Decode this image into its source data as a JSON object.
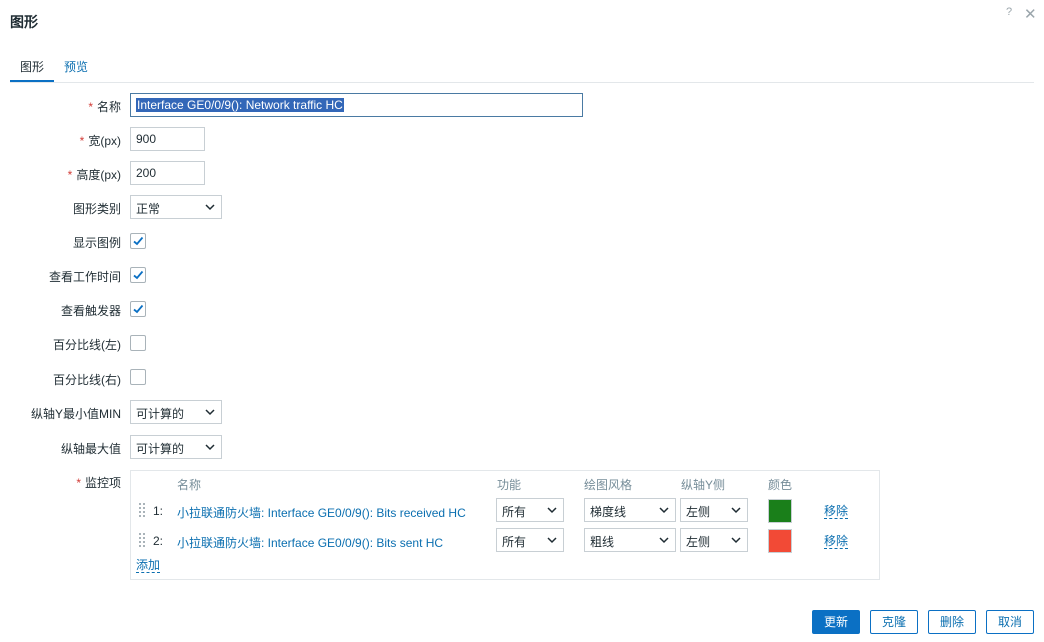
{
  "dialog": {
    "title": "图形",
    "help_glyph": "?",
    "close_glyph": "✕"
  },
  "tabs": [
    {
      "label": "图形",
      "active": true
    },
    {
      "label": "预览",
      "active": false
    }
  ],
  "form": {
    "name": {
      "label": "名称",
      "required": true,
      "value": "Interface GE0/0/9(): Network traffic HC"
    },
    "width": {
      "label": "宽(px)",
      "required": true,
      "value": "900"
    },
    "height": {
      "label": "高度(px)",
      "required": true,
      "value": "200"
    },
    "graph_type": {
      "label": "图形类别",
      "value": "正常"
    },
    "show_legend": {
      "label": "显示图例",
      "checked": true
    },
    "show_working_time": {
      "label": "查看工作时间",
      "checked": true
    },
    "show_triggers": {
      "label": "查看触发器",
      "checked": true
    },
    "percentile_left": {
      "label": "百分比线(左)",
      "checked": false
    },
    "percentile_right": {
      "label": "百分比线(右)",
      "checked": false
    },
    "ymin": {
      "label": "纵轴Y最小值MIN",
      "value": "可计算的"
    },
    "ymax": {
      "label": "纵轴最大值",
      "value": "可计算的"
    },
    "items_label": "监控项",
    "required_mark": "*"
  },
  "items": {
    "headers": {
      "name": "名称",
      "function": "功能",
      "draw_style": "绘图风格",
      "y_side": "纵轴Y侧",
      "color": "颜色"
    },
    "rows": [
      {
        "num": "1:",
        "name": "小拉联通防火墙: Interface GE0/0/9(): Bits received HC",
        "function": "所有",
        "draw_style": "梯度线",
        "y_side": "左侧",
        "color": "#1a7f1a",
        "remove": "移除"
      },
      {
        "num": "2:",
        "name": "小拉联通防火墙: Interface GE0/0/9(): Bits sent HC",
        "function": "所有",
        "draw_style": "粗线",
        "y_side": "左侧",
        "color": "#f24a36",
        "remove": "移除"
      }
    ],
    "add": "添加"
  },
  "buttons": {
    "update": "更新",
    "clone": "克隆",
    "delete": "删除",
    "cancel": "取消"
  }
}
